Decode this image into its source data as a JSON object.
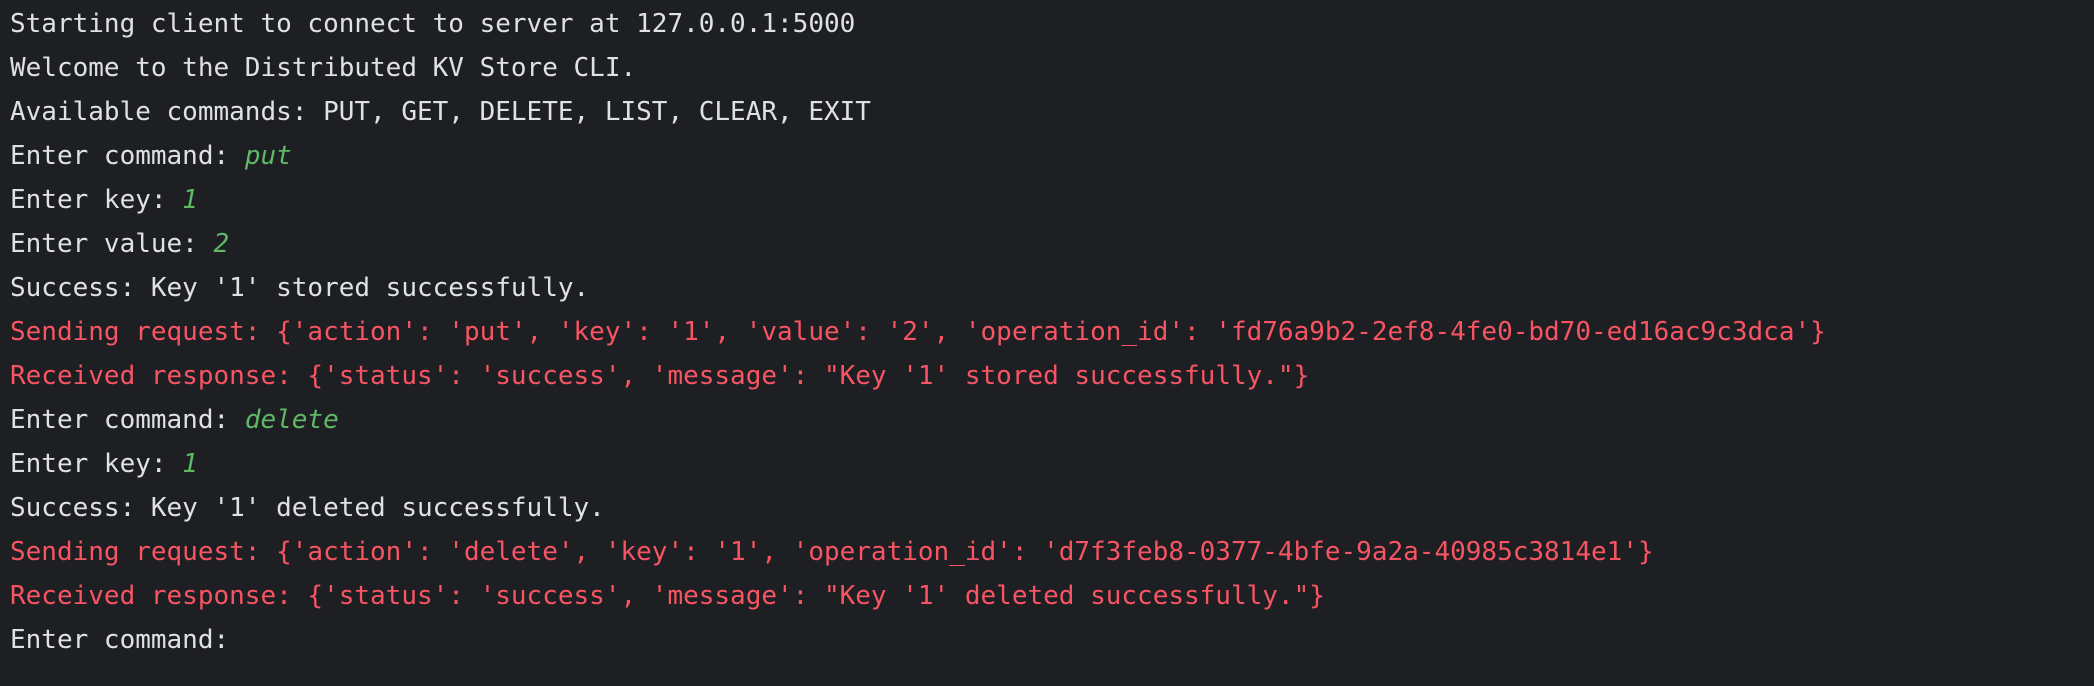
{
  "console": {
    "lines": [
      {
        "text": "Starting client to connect to server at 127.0.0.1:5000"
      },
      {
        "text": "Welcome to the Distributed KV Store CLI."
      },
      {
        "text": "Available commands: PUT, GET, DELETE, LIST, CLEAR, EXIT"
      },
      {
        "prompt": "Enter command: ",
        "input": "put"
      },
      {
        "prompt": "Enter key: ",
        "input": "1"
      },
      {
        "prompt": "Enter value: ",
        "input": "2"
      },
      {
        "text": "Success: Key '1' stored successfully."
      },
      {
        "text": "Sending request: {'action': 'put', 'key': '1', 'value': '2', 'operation_id': 'fd76a9b2-2ef8-4fe0-bd70-ed16ac9c3dca'}"
      },
      {
        "text": "Received response: {'status': 'success', 'message': \"Key '1' stored successfully.\"}"
      },
      {
        "prompt": "Enter command: ",
        "input": "delete"
      },
      {
        "prompt": "Enter key: ",
        "input": "1"
      },
      {
        "text": "Success: Key '1' deleted successfully."
      },
      {
        "text": "Sending request: {'action': 'delete', 'key': '1', 'operation_id': 'd7f3feb8-0377-4bfe-9a2a-40985c3814e1'}"
      },
      {
        "text": "Received response: {'status': 'success', 'message': \"Key '1' deleted successfully.\"}"
      },
      {
        "prompt": "Enter command: ",
        "input": ""
      }
    ]
  },
  "colors": {
    "background": "#1e1f22",
    "stdout": "#dfe1e5",
    "stderr": "#f75464",
    "user_input": "#5fb865"
  }
}
